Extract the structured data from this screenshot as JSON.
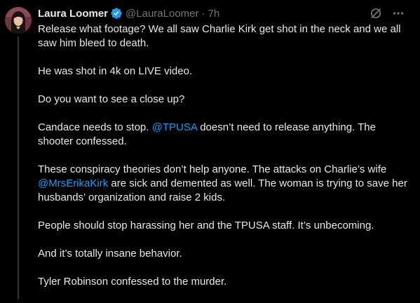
{
  "author": {
    "display_name": "Laura Loomer",
    "handle": "@LauraLoomer",
    "separator": "·",
    "timestamp": "7h"
  },
  "icons": {
    "verified": "verified-badge-icon",
    "grok": "grok-icon",
    "more": "more-icon"
  },
  "colors": {
    "background": "#000000",
    "text": "#e7e9ea",
    "secondary": "#71767b",
    "link": "#1d9bf0",
    "verified": "#1d9bf0"
  },
  "post": {
    "p1": "Release what footage? We all saw Charlie Kirk get shot in the neck and we all saw him bleed to death.",
    "p2": "He was shot in 4k on LIVE video.",
    "p3": "Do you want to see a close up?",
    "p4": {
      "before": "Candace needs to stop. ",
      "mention": "@TPUSA",
      "after": " doesn’t need to release anything. The shooter confessed."
    },
    "p5": {
      "before": "These conspiracy theories don’t help anyone. The attacks on Charlie’s wife ",
      "mention": "@MrsErikaKirk",
      "after": " are sick and demented as well. The woman is trying to save her husbands’ organization and raise 2 kids."
    },
    "p6": "People should stop harassing her and the TPUSA staff. It’s unbecoming.",
    "p7": "And it’s totally insane behavior.",
    "p8": "Tyler Robinson confessed to the murder."
  }
}
